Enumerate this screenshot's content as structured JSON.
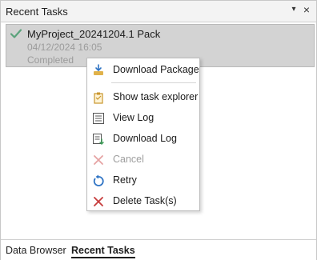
{
  "panel": {
    "title": "Recent Tasks",
    "pin_glyph": "▾",
    "close_glyph": "×"
  },
  "task": {
    "name": "MyProject_20241204.1 Pack",
    "date": "04/12/2024 16:05",
    "status": "Completed",
    "icon": "checkmark-icon",
    "accent": "#5ba37c"
  },
  "context_menu": {
    "items": [
      {
        "label": "Download Package",
        "icon": "download-package-icon",
        "enabled": true
      },
      {
        "label": "Show task explorer",
        "icon": "clipboard-icon",
        "enabled": true
      },
      {
        "label": "View Log",
        "icon": "list-icon",
        "enabled": true
      },
      {
        "label": "Download Log",
        "icon": "download-log-icon",
        "enabled": true
      },
      {
        "label": "Cancel",
        "icon": "cancel-icon",
        "enabled": false
      },
      {
        "label": "Retry",
        "icon": "retry-icon",
        "enabled": true
      },
      {
        "label": "Delete Task(s)",
        "icon": "delete-icon",
        "enabled": true
      }
    ]
  },
  "tabs": [
    {
      "label": "Data Browser",
      "active": false
    },
    {
      "label": "Recent Tasks",
      "active": true
    }
  ],
  "colors": {
    "selection_bg": "#d3d3d3",
    "retry_blue": "#2e73c4",
    "delete_red": "#c63b3b"
  }
}
